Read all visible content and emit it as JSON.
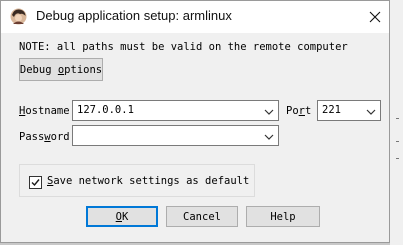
{
  "window": {
    "title": "Debug application setup: armlinux"
  },
  "note": "NOTE: all paths must be valid on the remote computer",
  "buttons": {
    "debug_options": {
      "prefix": "Debug ",
      "mnemonic": "o",
      "suffix": "ptions"
    },
    "ok": {
      "prefix": "",
      "mnemonic": "O",
      "suffix": "K"
    },
    "cancel": {
      "label": "Cancel"
    },
    "help": {
      "label": "Help"
    }
  },
  "fields": {
    "hostname": {
      "label_mnemonic": "H",
      "label_rest": "ostname",
      "value": "127.0.0.1"
    },
    "port": {
      "label_prefix": "Po",
      "label_mnemonic": "r",
      "label_rest": "t",
      "value": "221"
    },
    "password": {
      "label_prefix": "Pass",
      "label_mnemonic": "w",
      "label_rest": "ord",
      "value": ""
    }
  },
  "save_settings": {
    "checked": true,
    "label_mnemonic": "S",
    "label_rest": "ave network settings as default"
  },
  "icons": {
    "app": "user-avatar-icon",
    "close": "close-icon",
    "dropdown": "chevron-down-icon",
    "check": "checkmark-icon"
  },
  "colors": {
    "default_button_border": "#0078d7",
    "window_background": "#f0f0f0"
  }
}
